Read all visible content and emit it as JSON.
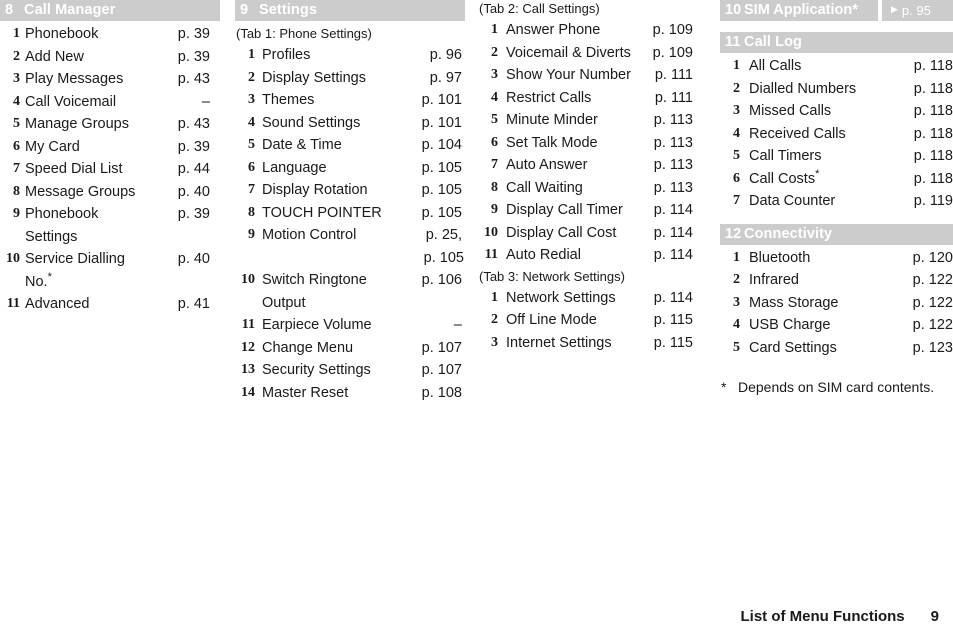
{
  "meta": {
    "footer_title": "List of Menu Functions",
    "footer_page": "9",
    "footnote_mark": "*",
    "footnote_text": "Depends on SIM card contents.",
    "header_bar_color": "#cccccc",
    "header_text_color": "#ffffff",
    "body_text_color": "#1a1a1a"
  },
  "columns": {
    "call_manager": {
      "header": {
        "number": "8",
        "label": "Call Manager"
      },
      "items": [
        {
          "n": "1",
          "label": "Phonebook",
          "page": "p. 39"
        },
        {
          "n": "2",
          "label": "Add New",
          "page": "p. 39"
        },
        {
          "n": "3",
          "label": "Play Messages",
          "page": "p. 43"
        },
        {
          "n": "4",
          "label": "Call Voicemail",
          "page": "–"
        },
        {
          "n": "5",
          "label": "Manage Groups",
          "page": "p. 43"
        },
        {
          "n": "6",
          "label": "My Card",
          "page": "p. 39"
        },
        {
          "n": "7",
          "label": "Speed Dial List",
          "page": "p. 44"
        },
        {
          "n": "8",
          "label": "Message Groups",
          "page": "p. 40"
        },
        {
          "n": "9",
          "label": "Phonebook Settings",
          "page": "p. 39"
        },
        {
          "n": "10",
          "label": "Service Dialling No.",
          "star": "*",
          "page": "p. 40"
        },
        {
          "n": "11",
          "label": "Advanced",
          "page": "p. 41"
        }
      ]
    },
    "settings": {
      "header": {
        "number": "9",
        "label": "Settings"
      },
      "caption": "(Tab 1: Phone Settings)",
      "items": [
        {
          "n": "1",
          "label": "Profiles",
          "page": "p. 96"
        },
        {
          "n": "2",
          "label": "Display Settings",
          "page": "p. 97"
        },
        {
          "n": "3",
          "label": "Themes",
          "page": "p. 101"
        },
        {
          "n": "4",
          "label": "Sound Settings",
          "page": "p. 101"
        },
        {
          "n": "5",
          "label": "Date & Time",
          "page": "p. 104"
        },
        {
          "n": "6",
          "label": "Language",
          "page": "p. 105"
        },
        {
          "n": "7",
          "label": "Display Rotation",
          "page": "p. 105"
        },
        {
          "n": "8",
          "label": "TOUCH POINTER",
          "page": "p. 105"
        },
        {
          "n": "9",
          "label": "Motion Control",
          "page": "p. 25,",
          "page_extra": "p. 105"
        },
        {
          "n": "10",
          "label": "Switch Ringtone Output",
          "page": "p. 106"
        },
        {
          "n": "11",
          "label": "Earpiece Volume",
          "page": "–"
        },
        {
          "n": "12",
          "label": "Change Menu",
          "page": "p. 107"
        },
        {
          "n": "13",
          "label": "Security Settings",
          "page": "p. 107"
        },
        {
          "n": "14",
          "label": "Master Reset",
          "page": "p. 108"
        }
      ]
    },
    "call_settings": {
      "caption": "(Tab 2: Call Settings)",
      "items": [
        {
          "n": "1",
          "label": "Answer Phone",
          "page": "p. 109"
        },
        {
          "n": "2",
          "label": "Voicemail & Diverts",
          "page": "p. 109"
        },
        {
          "n": "3",
          "label": "Show Your Number",
          "page": "p. 111"
        },
        {
          "n": "4",
          "label": "Restrict Calls",
          "page": "p. 111"
        },
        {
          "n": "5",
          "label": "Minute Minder",
          "page": "p. 113"
        },
        {
          "n": "6",
          "label": "Set Talk Mode",
          "page": "p. 113"
        },
        {
          "n": "7",
          "label": "Auto Answer",
          "page": "p. 113"
        },
        {
          "n": "8",
          "label": "Call Waiting",
          "page": "p. 113"
        },
        {
          "n": "9",
          "label": "Display Call Timer",
          "page": "p. 114"
        },
        {
          "n": "10",
          "label": "Display Call Cost",
          "page": "p. 114"
        },
        {
          "n": "11",
          "label": "Auto Redial",
          "page": "p. 114"
        }
      ],
      "caption2": "(Tab 3: Network Settings)",
      "items2": [
        {
          "n": "1",
          "label": "Network Settings",
          "page": "p. 114"
        },
        {
          "n": "2",
          "label": "Off Line Mode",
          "page": "p. 115"
        },
        {
          "n": "3",
          "label": "Internet Settings",
          "page": "p. 115"
        }
      ]
    },
    "sim_application": {
      "header": {
        "number": "10",
        "label": "SIM Application",
        "star": "*"
      },
      "ref": {
        "arrow": "▶",
        "page": "p. 95"
      }
    },
    "call_log": {
      "header": {
        "number": "11",
        "label": "Call Log"
      },
      "items": [
        {
          "n": "1",
          "label": "All Calls",
          "page": "p. 118"
        },
        {
          "n": "2",
          "label": "Dialled Numbers",
          "page": "p. 118"
        },
        {
          "n": "3",
          "label": "Missed Calls",
          "page": "p. 118"
        },
        {
          "n": "4",
          "label": "Received Calls",
          "page": "p. 118"
        },
        {
          "n": "5",
          "label": "Call Timers",
          "page": "p. 118"
        },
        {
          "n": "6",
          "label": "Call Costs",
          "star": "*",
          "page": "p. 118"
        },
        {
          "n": "7",
          "label": "Data Counter",
          "page": "p. 119"
        }
      ]
    },
    "connectivity": {
      "header": {
        "number": "12",
        "label": "Connectivity"
      },
      "items": [
        {
          "n": "1",
          "label": "Bluetooth",
          "page": "p. 120"
        },
        {
          "n": "2",
          "label": "Infrared",
          "page": "p. 122"
        },
        {
          "n": "3",
          "label": "Mass Storage",
          "page": "p. 122"
        },
        {
          "n": "4",
          "label": "USB Charge",
          "page": "p. 122"
        },
        {
          "n": "5",
          "label": "Card Settings",
          "page": "p. 123"
        }
      ]
    }
  }
}
